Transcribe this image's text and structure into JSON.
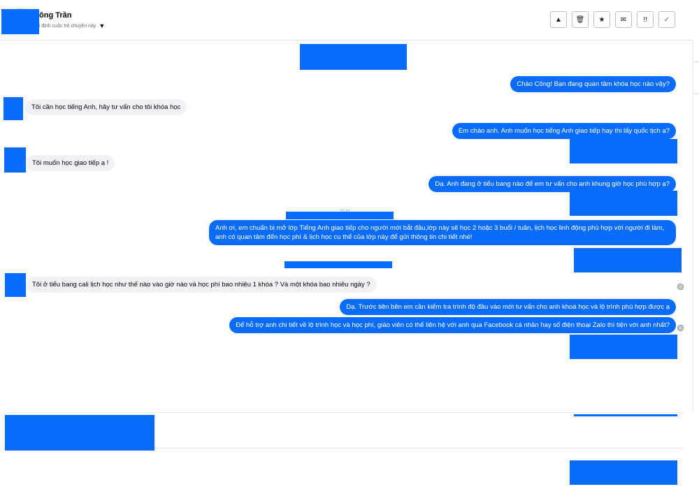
{
  "header": {
    "contact_name": "ông Trần",
    "subtitle": "ỉ định cuộc trò chuyện này",
    "caret": "▼",
    "toolbar": [
      {
        "name": "alert-icon",
        "glyph": "▲"
      },
      {
        "name": "trash-icon",
        "glyph": "🗑"
      },
      {
        "name": "star-icon",
        "glyph": "★"
      },
      {
        "name": "mail-icon",
        "glyph": "✉"
      },
      {
        "name": "spam-icon",
        "glyph": "!!"
      },
      {
        "name": "check-icon",
        "glyph": "✓"
      }
    ]
  },
  "messages": [
    {
      "direction": "out",
      "text": "Chào Công! Bạn đang quan tâm khóa học nào vậy?"
    },
    {
      "direction": "in",
      "text": "Tôi cần học tiếng Anh, hãy tư vấn cho tôi khóa học"
    },
    {
      "direction": "out",
      "text": "Em chào anh. Anh muốn học tiếng Anh giao tiếp hay thi lấy quốc tịch ạ?"
    },
    {
      "direction": "in",
      "text": "Tôi muốn học giao tiếp ạ !"
    },
    {
      "direction": "out",
      "text": "Dạ. Anh đang ở tiểu bang nào để em tư vấn cho anh khung giờ học phù hợp ạ?"
    },
    {
      "direction": "out",
      "text": "Anh ơi, em chuẩn bị mở lớp Tiếng Anh giao tiếp cho người mới bắt đầu,lớp này sẽ học 2 hoặc 3 buổi / tuần, lịch học linh động phù hợp với người đi làm, anh có quan tâm đến học phí & lịch học cụ thể của lớp này để gửi thông tin chi tiết nhé!"
    },
    {
      "direction": "in",
      "text": "Tôi ở tiểu bang cali  lịch học như thế nào vào giờ nào và học phí bao nhiêu 1 khóa ? Và một khóa bao nhiêu ngày ?"
    },
    {
      "direction": "out",
      "text": "Dạ. Trước tiên bên em cần kiểm tra trình độ đầu vào mới tư vấn cho anh khoá học và lộ trình phù hợp được ạ"
    },
    {
      "direction": "out",
      "text": "Để hỗ trợ anh chi tiết về lộ trình học và học phí, giáo viên có thể liên hệ với anh qua Facebook cá nhân hay số điện thoại Zalo thì tiện với anh nhất?"
    }
  ],
  "timestamp_text": "20:31",
  "composer": {
    "placeholder": ""
  },
  "colors": {
    "outgoing_bubble": "#0a6cff",
    "incoming_bubble": "#f0f2f5",
    "redaction": "#0a6cff"
  }
}
